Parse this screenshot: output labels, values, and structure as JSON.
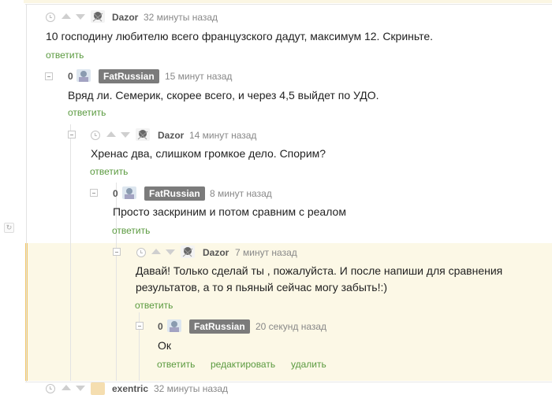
{
  "comments": [
    {
      "rating": "",
      "user": "Dazor",
      "time": "32 минуты назад",
      "lines": [
        "10 господину любителю всего французского дадут, максимум 12. Скриньте."
      ],
      "actions": [
        "ответить"
      ]
    },
    {
      "rating": "0",
      "user": "FatRussian",
      "time": "15 минут назад",
      "lines": [
        "Вряд ли. Семерик, скорее всего, и через 4,5 выйдет по УДО."
      ],
      "actions": [
        "ответить"
      ]
    },
    {
      "rating": "",
      "user": "Dazor",
      "time": "14 минут назад",
      "lines": [
        "Хренас два, слишком громкое дело. Спорим?"
      ],
      "actions": [
        "ответить"
      ]
    },
    {
      "rating": "0",
      "user": "FatRussian",
      "time": "8 минут назад",
      "lines": [
        "Просто заскриним и потом сравним с реалом"
      ],
      "actions": [
        "ответить"
      ]
    },
    {
      "rating": "",
      "user": "Dazor",
      "time": "7 минут назад",
      "lines": [
        "Давай! Только сделай ты , пожалуйста. И после напиши для сравнения",
        "результатов, а то я пьяный сейчас могу забыть!:)"
      ],
      "actions": [
        "ответить"
      ]
    },
    {
      "rating": "0",
      "user": "FatRussian",
      "time": "20 секунд назад",
      "lines": [
        "Ок"
      ],
      "actions": [
        "ответить",
        "редактировать",
        "удалить"
      ]
    },
    {
      "rating": "",
      "user": "exentric",
      "time": "32 минуты назад",
      "lines": [],
      "actions": []
    }
  ],
  "colors": {
    "link": "#5a9a3f",
    "highlight": "#fcf8e6",
    "accent_bar": "#f2c86a",
    "badge": "#7b7b7b"
  },
  "icons": {
    "toggle": "collapse-minus-icon",
    "time": "clock-icon",
    "vote_up": "arrow-up-icon",
    "vote_down": "arrow-down-icon",
    "refresh": "refresh-icon"
  }
}
